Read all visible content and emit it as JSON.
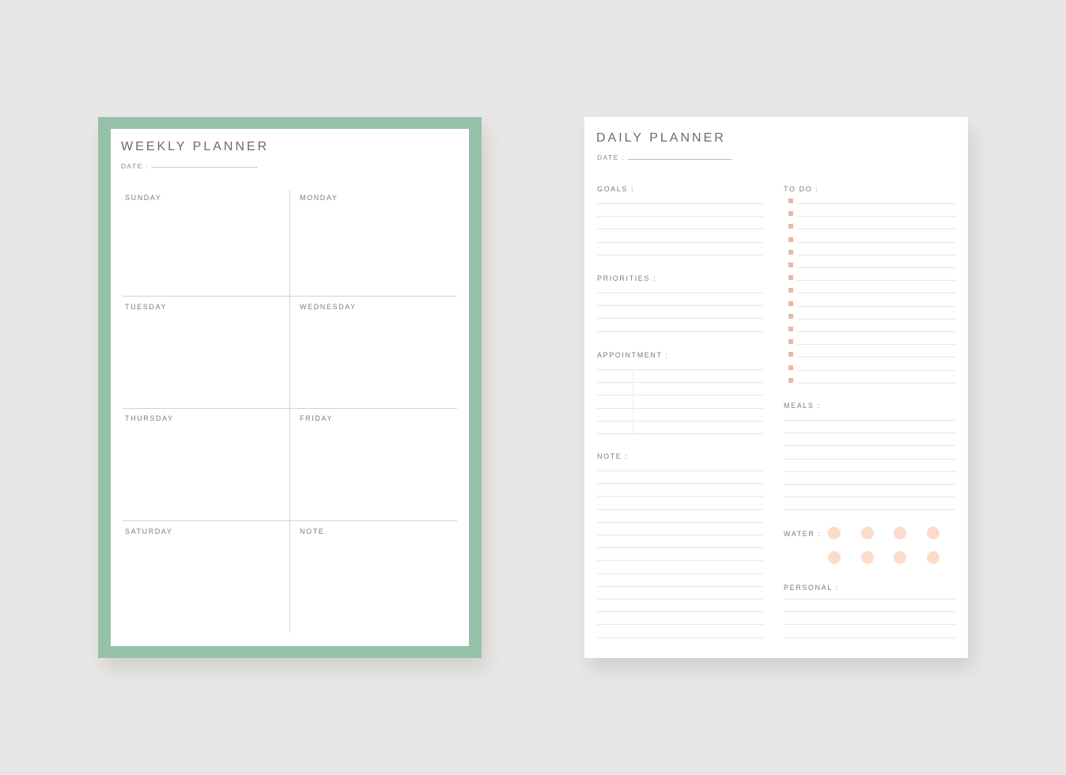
{
  "weekly_planner": {
    "title": "WEEKLY PLANNER",
    "date_label": "DATE :",
    "frame_color": "#96c1a9",
    "cells": [
      {
        "label": "SUNDAY"
      },
      {
        "label": "MONDAY"
      },
      {
        "label": "TUESDAY"
      },
      {
        "label": "WEDNESDAY"
      },
      {
        "label": "THURSDAY"
      },
      {
        "label": "FRIDAY"
      },
      {
        "label": "SATURDAY"
      },
      {
        "label": "NOTE"
      }
    ]
  },
  "daily_planner": {
    "title": "DAILY PLANNER",
    "date_label": "DATE :",
    "sections": {
      "goals": {
        "label": "GOALS :",
        "line_count": 5
      },
      "priorities": {
        "label": "PRIORITIES  :",
        "line_count": 4
      },
      "appointment": {
        "label": "APPOINTMENT :",
        "row_count": 6
      },
      "note": {
        "label": "NOTE :",
        "line_count": 14
      },
      "todo": {
        "label": "TO DO :",
        "item_count": 15
      },
      "meals": {
        "label": "MEALS :",
        "line_count": 8
      },
      "water": {
        "label": "WATER :",
        "glass_count": 8
      },
      "personal": {
        "label": "PERSONAL :",
        "line_count": 4
      }
    },
    "checkbox_color": "#eeb4a7",
    "water_color": "#fbdcca"
  }
}
